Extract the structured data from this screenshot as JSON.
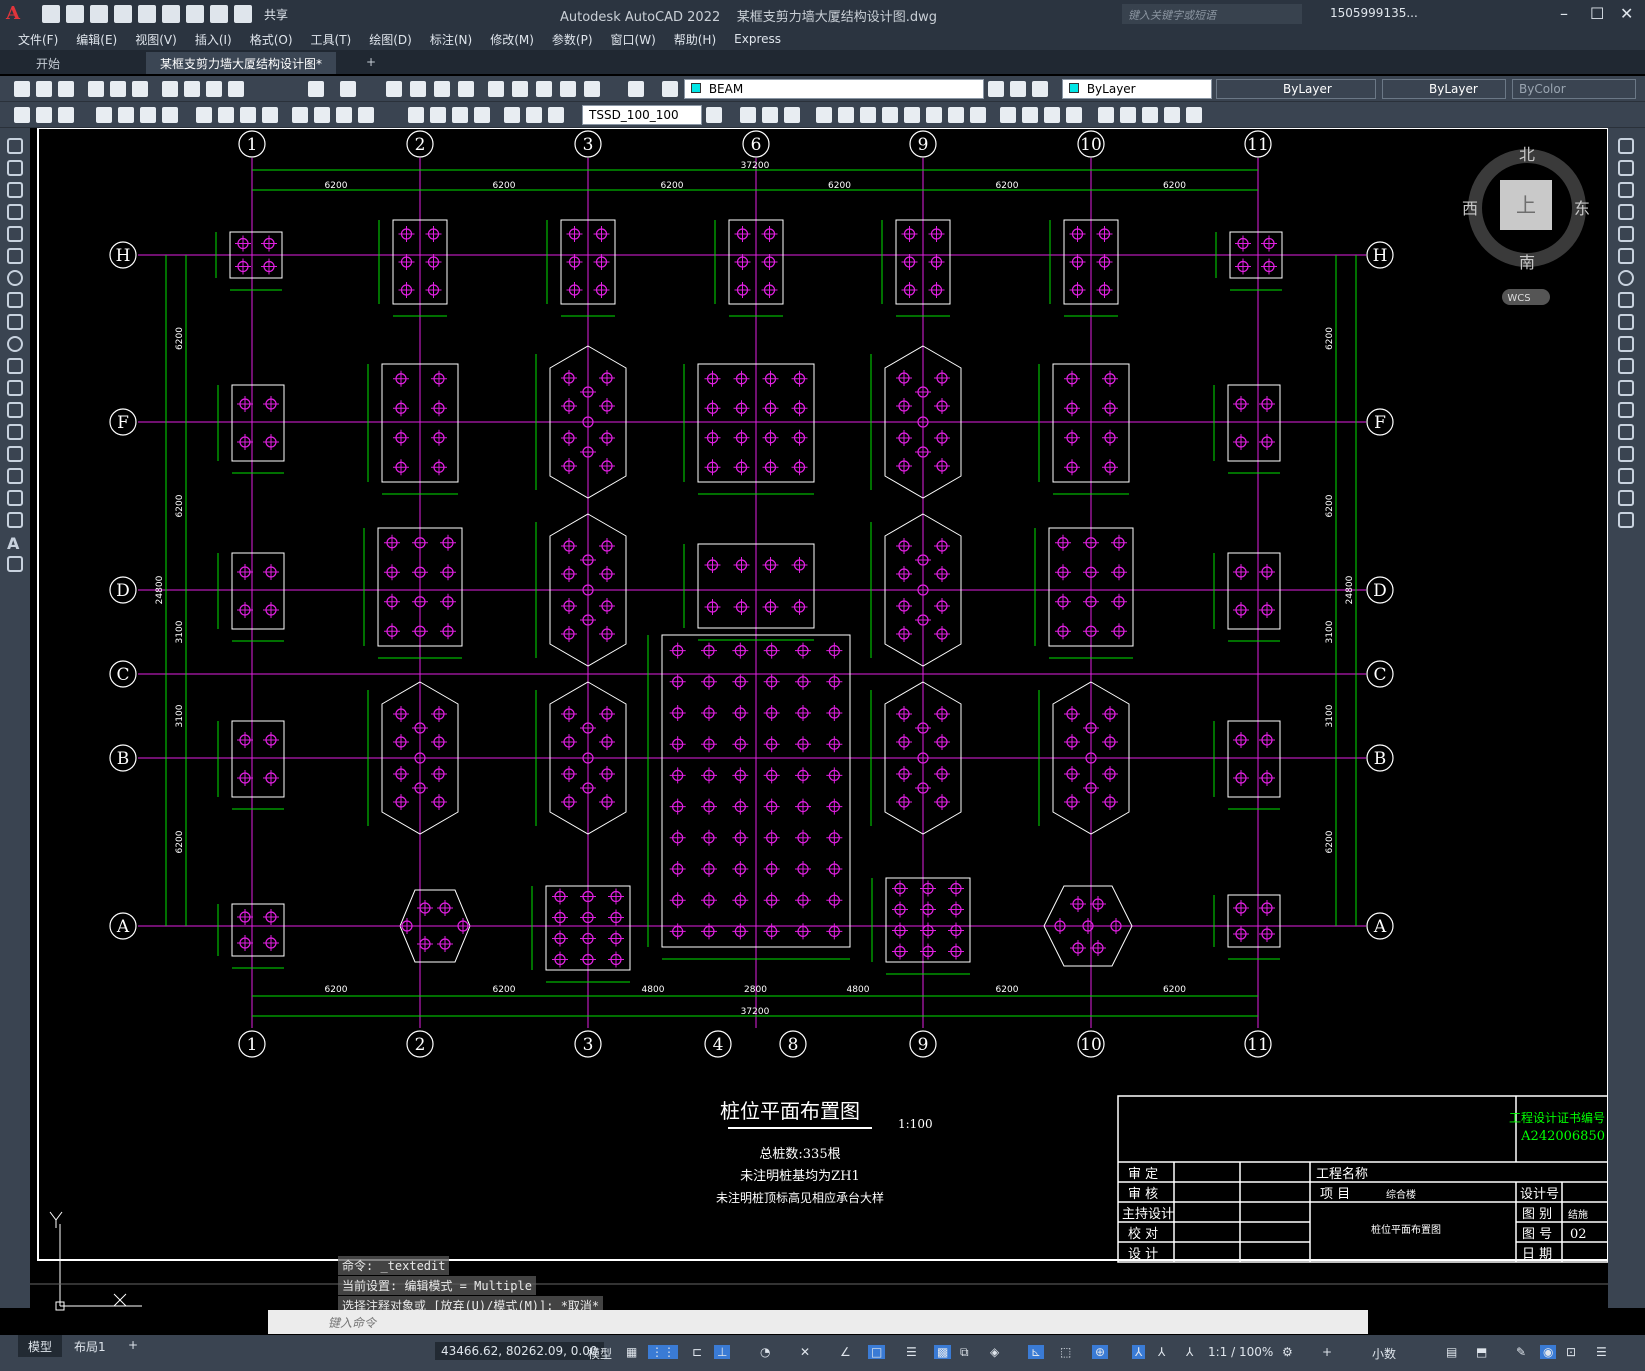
{
  "app": {
    "title": "Autodesk AutoCAD 2022",
    "file": "某框支剪力墙大厦结构设计图.dwg",
    "logo": "A",
    "share": "共享",
    "search_placeholder": "键入关键字或短语",
    "user": "1505999135...",
    "window_controls": [
      "–",
      "☐",
      "✕"
    ]
  },
  "menu": [
    "文件(F)",
    "编辑(E)",
    "视图(V)",
    "插入(I)",
    "格式(O)",
    "工具(T)",
    "绘图(D)",
    "标注(N)",
    "修改(M)",
    "参数(P)",
    "窗口(W)",
    "帮助(H)",
    "Express"
  ],
  "tabs": [
    {
      "label": "开始"
    },
    {
      "label": "某框支剪力墙大厦结构设计图*"
    },
    {
      "label": "+"
    }
  ],
  "toolbar": {
    "layer": "BEAM",
    "color": "ByLayer",
    "linetype": "ByLayer",
    "lineweight": "ByLayer",
    "plotstyle": "ByColor",
    "dimstyle": "TSSD_100_100"
  },
  "viewcube": {
    "north": "北",
    "south": "南",
    "east": "东",
    "west": "西",
    "top": "上",
    "wcs": "WCS"
  },
  "drawing": {
    "col_labels_top": [
      "1",
      "2",
      "3",
      "6",
      "9",
      "10",
      "11"
    ],
    "col_labels_bottom": [
      "1",
      "2",
      "3",
      "4",
      "8",
      "9",
      "10",
      "11"
    ],
    "row_labels": [
      "H",
      "F",
      "D",
      "C",
      "B",
      "A"
    ],
    "top_total": "37200",
    "top_spans": [
      "6200",
      "6200",
      "6200",
      "6200",
      "6200",
      "6200"
    ],
    "bottom_total": "37200",
    "bottom_spans": [
      "6200",
      "6200",
      "4800",
      "2800",
      "4800",
      "6200",
      "6200"
    ],
    "left_total": "24800",
    "left_spans": [
      "6200",
      "6200",
      "3100",
      "3100",
      "6200"
    ],
    "title": "桩位平面布置图",
    "scale": "1:100",
    "notes": [
      "总桩数:335根",
      "未注明桩基均为ZH1",
      "未注明桩顶标高见相应承台大样"
    ],
    "cert_label": "工程设计证书编号",
    "cert_no": "A242006850",
    "title_block": {
      "rows": [
        "审 定",
        "审 核",
        "主持设计",
        "校 对",
        "设 计"
      ],
      "project_name": "工程名称",
      "item": "项 目",
      "item_value": "综合楼",
      "drawing_name": "桩位平面布置图",
      "design_no": "设计号",
      "category": "图 别",
      "category_value": "结施",
      "sheet_no": "图 号",
      "sheet_value": "02",
      "date": "日 期"
    }
  },
  "command": {
    "history": [
      "命令: _textedit",
      "当前设置: 编辑模式 = Multiple",
      "选择注释对象或 [放弃(U)/模式(M)]: *取消*"
    ],
    "prompt": "键入命令"
  },
  "status": {
    "coords": "43466.62, 80262.09, 0.00",
    "mode": "模型",
    "scale": "1:1 / 100%",
    "units": "小数",
    "layout_tabs": [
      "模型",
      "布局1",
      "+"
    ]
  }
}
